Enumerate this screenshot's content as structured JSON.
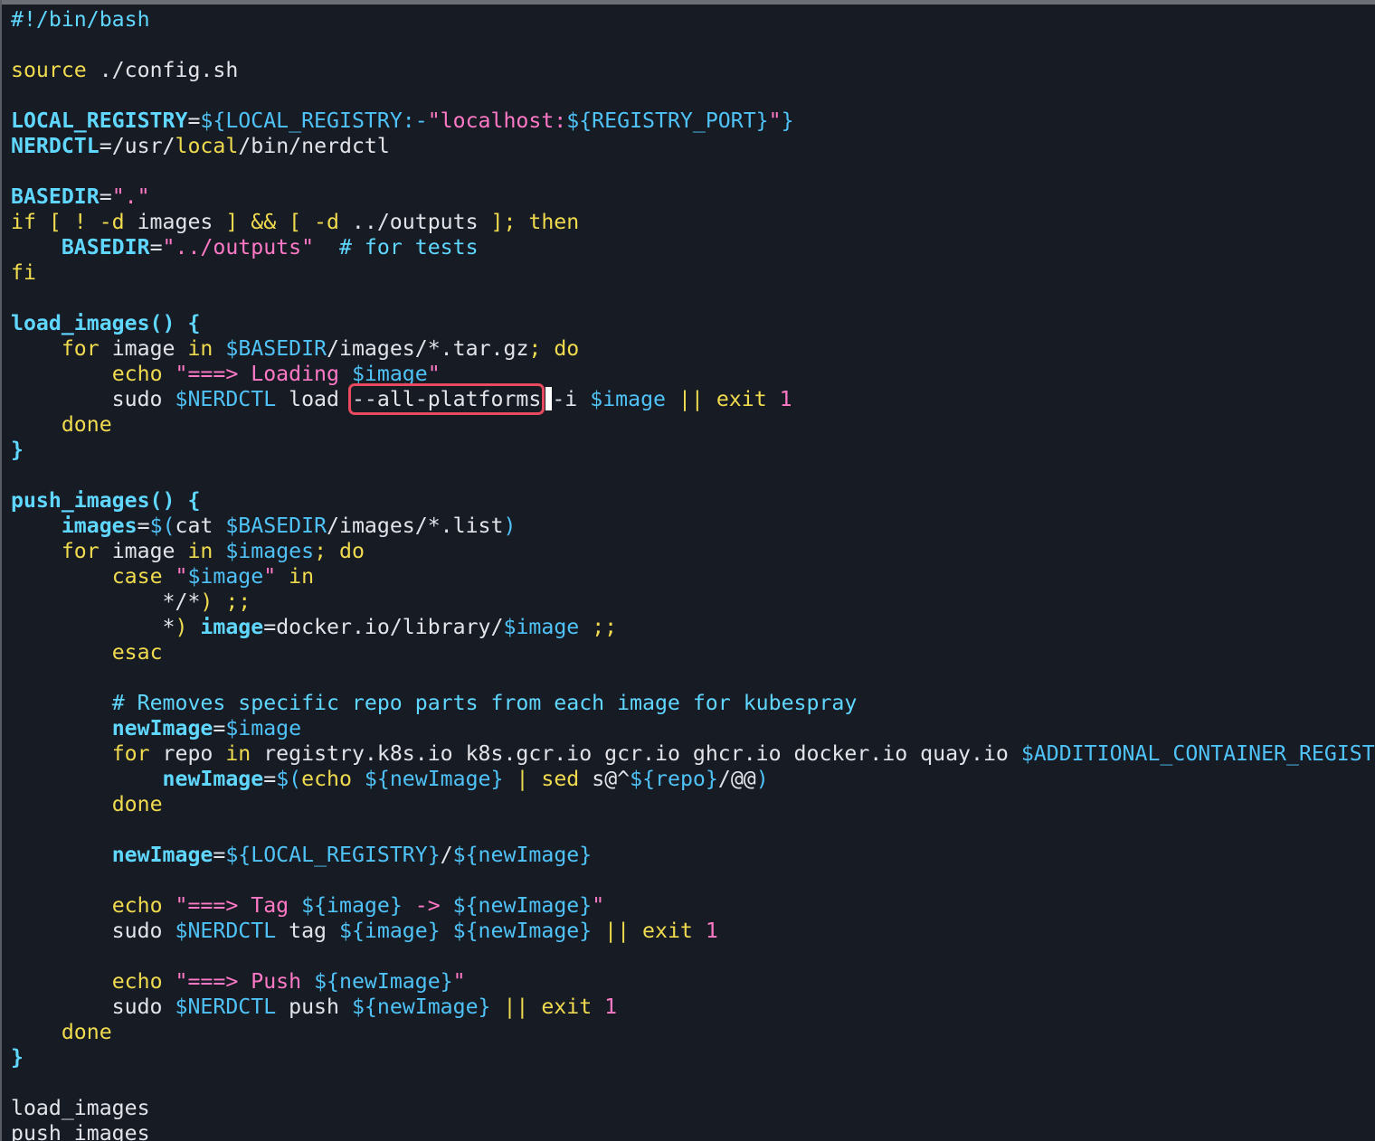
{
  "editor": {
    "colors": {
      "background": "#171b24",
      "text": "#e2e4e9",
      "keyword": "#f0db4f",
      "variable": "#5fd7ff",
      "string": "#ff79c6",
      "highlight_box": "#e84a5f"
    },
    "lines": [
      [
        {
          "t": "comment",
          "s": "#!/bin/bash"
        }
      ],
      [],
      [
        {
          "t": "keyword",
          "s": "source"
        },
        {
          "t": "plain",
          "s": " ./config.sh"
        }
      ],
      [],
      [
        {
          "t": "var",
          "s": "LOCAL_REGISTRY"
        },
        {
          "t": "plain",
          "s": "="
        },
        {
          "t": "varref",
          "s": "${LOCAL_REGISTRY:-"
        },
        {
          "t": "string",
          "s": "\"localhost:"
        },
        {
          "t": "varref",
          "s": "${REGISTRY_PORT}"
        },
        {
          "t": "string",
          "s": "\""
        },
        {
          "t": "varref",
          "s": "}"
        }
      ],
      [
        {
          "t": "var",
          "s": "NERDCTL"
        },
        {
          "t": "plain",
          "s": "=/usr/"
        },
        {
          "t": "keyword",
          "s": "local"
        },
        {
          "t": "plain",
          "s": "/bin/nerdctl"
        }
      ],
      [],
      [
        {
          "t": "var",
          "s": "BASEDIR"
        },
        {
          "t": "plain",
          "s": "="
        },
        {
          "t": "string",
          "s": "\".\""
        }
      ],
      [
        {
          "t": "keyword",
          "s": "if [ ! -d"
        },
        {
          "t": "plain",
          "s": " images "
        },
        {
          "t": "keyword",
          "s": "] && [ -d"
        },
        {
          "t": "plain",
          "s": " ../outputs "
        },
        {
          "t": "keyword",
          "s": "]; then"
        }
      ],
      [
        {
          "t": "plain",
          "s": "    "
        },
        {
          "t": "var",
          "s": "BASEDIR"
        },
        {
          "t": "plain",
          "s": "="
        },
        {
          "t": "string",
          "s": "\"../outputs\""
        },
        {
          "t": "plain",
          "s": "  "
        },
        {
          "t": "comment",
          "s": "# for tests"
        }
      ],
      [
        {
          "t": "keyword",
          "s": "fi"
        }
      ],
      [],
      [
        {
          "t": "func",
          "s": "load_images() {"
        }
      ],
      [
        {
          "t": "plain",
          "s": "    "
        },
        {
          "t": "keyword",
          "s": "for"
        },
        {
          "t": "plain",
          "s": " image "
        },
        {
          "t": "keyword",
          "s": "in"
        },
        {
          "t": "plain",
          "s": " "
        },
        {
          "t": "varref",
          "s": "$BASEDIR"
        },
        {
          "t": "plain",
          "s": "/images/*.tar.gz"
        },
        {
          "t": "keyword",
          "s": "; do"
        }
      ],
      [
        {
          "t": "plain",
          "s": "        "
        },
        {
          "t": "keyword",
          "s": "echo"
        },
        {
          "t": "plain",
          "s": " "
        },
        {
          "t": "string",
          "s": "\"===> Loading "
        },
        {
          "t": "varref",
          "s": "$image"
        },
        {
          "t": "string",
          "s": "\""
        }
      ],
      [
        {
          "t": "plain",
          "s": "        sudo "
        },
        {
          "t": "varref",
          "s": "$NERDCTL"
        },
        {
          "t": "plain",
          "s": " load "
        },
        {
          "t": "hl",
          "s": "--all-platforms"
        },
        {
          "t": "cursor",
          "s": ""
        },
        {
          "t": "plain",
          "s": "-i "
        },
        {
          "t": "varref",
          "s": "$image"
        },
        {
          "t": "plain",
          "s": " "
        },
        {
          "t": "keyword",
          "s": "|| exit"
        },
        {
          "t": "plain",
          "s": " "
        },
        {
          "t": "num",
          "s": "1"
        }
      ],
      [
        {
          "t": "plain",
          "s": "    "
        },
        {
          "t": "keyword",
          "s": "done"
        }
      ],
      [
        {
          "t": "brace",
          "s": "}"
        }
      ],
      [],
      [
        {
          "t": "func",
          "s": "push_images() {"
        }
      ],
      [
        {
          "t": "plain",
          "s": "    "
        },
        {
          "t": "var",
          "s": "images"
        },
        {
          "t": "plain",
          "s": "="
        },
        {
          "t": "varref",
          "s": "$("
        },
        {
          "t": "plain",
          "s": "cat "
        },
        {
          "t": "varref",
          "s": "$BASEDIR"
        },
        {
          "t": "plain",
          "s": "/images/*.list"
        },
        {
          "t": "varref",
          "s": ")"
        }
      ],
      [
        {
          "t": "plain",
          "s": "    "
        },
        {
          "t": "keyword",
          "s": "for"
        },
        {
          "t": "plain",
          "s": " image "
        },
        {
          "t": "keyword",
          "s": "in"
        },
        {
          "t": "plain",
          "s": " "
        },
        {
          "t": "varref",
          "s": "$images"
        },
        {
          "t": "keyword",
          "s": "; do"
        }
      ],
      [
        {
          "t": "plain",
          "s": "        "
        },
        {
          "t": "keyword",
          "s": "case"
        },
        {
          "t": "plain",
          "s": " "
        },
        {
          "t": "string",
          "s": "\""
        },
        {
          "t": "varref",
          "s": "$image"
        },
        {
          "t": "string",
          "s": "\""
        },
        {
          "t": "plain",
          "s": " "
        },
        {
          "t": "keyword",
          "s": "in"
        }
      ],
      [
        {
          "t": "plain",
          "s": "            */*"
        },
        {
          "t": "keyword",
          "s": ") ;;"
        }
      ],
      [
        {
          "t": "plain",
          "s": "            *"
        },
        {
          "t": "keyword",
          "s": ")"
        },
        {
          "t": "plain",
          "s": " "
        },
        {
          "t": "var",
          "s": "image"
        },
        {
          "t": "plain",
          "s": "=docker.io/library/"
        },
        {
          "t": "varref",
          "s": "$image"
        },
        {
          "t": "plain",
          "s": " "
        },
        {
          "t": "keyword",
          "s": ";;"
        }
      ],
      [
        {
          "t": "plain",
          "s": "        "
        },
        {
          "t": "keyword",
          "s": "esac"
        }
      ],
      [],
      [
        {
          "t": "plain",
          "s": "        "
        },
        {
          "t": "comment",
          "s": "# Removes specific repo parts from each image for kubespray"
        }
      ],
      [
        {
          "t": "plain",
          "s": "        "
        },
        {
          "t": "var",
          "s": "newImage"
        },
        {
          "t": "plain",
          "s": "="
        },
        {
          "t": "varref",
          "s": "$image"
        }
      ],
      [
        {
          "t": "plain",
          "s": "        "
        },
        {
          "t": "keyword",
          "s": "for"
        },
        {
          "t": "plain",
          "s": " repo "
        },
        {
          "t": "keyword",
          "s": "in"
        },
        {
          "t": "plain",
          "s": " registry.k8s.io k8s.gcr.io gcr.io ghcr.io docker.io quay.io "
        },
        {
          "t": "varref",
          "s": "$ADDITIONAL_CONTAINER_REGIST"
        }
      ],
      [
        {
          "t": "plain",
          "s": "            "
        },
        {
          "t": "var",
          "s": "newImage"
        },
        {
          "t": "plain",
          "s": "="
        },
        {
          "t": "varref",
          "s": "$("
        },
        {
          "t": "keyword",
          "s": "echo"
        },
        {
          "t": "plain",
          "s": " "
        },
        {
          "t": "varref",
          "s": "${newImage}"
        },
        {
          "t": "plain",
          "s": " "
        },
        {
          "t": "keyword",
          "s": "|"
        },
        {
          "t": "plain",
          "s": " "
        },
        {
          "t": "keyword",
          "s": "sed"
        },
        {
          "t": "plain",
          "s": " s@^"
        },
        {
          "t": "varref",
          "s": "${repo}"
        },
        {
          "t": "plain",
          "s": "/@@"
        },
        {
          "t": "varref",
          "s": ")"
        }
      ],
      [
        {
          "t": "plain",
          "s": "        "
        },
        {
          "t": "keyword",
          "s": "done"
        }
      ],
      [],
      [
        {
          "t": "plain",
          "s": "        "
        },
        {
          "t": "var",
          "s": "newImage"
        },
        {
          "t": "plain",
          "s": "="
        },
        {
          "t": "varref",
          "s": "${LOCAL_REGISTRY}"
        },
        {
          "t": "plain",
          "s": "/"
        },
        {
          "t": "varref",
          "s": "${newImage}"
        }
      ],
      [],
      [
        {
          "t": "plain",
          "s": "        "
        },
        {
          "t": "keyword",
          "s": "echo"
        },
        {
          "t": "plain",
          "s": " "
        },
        {
          "t": "string",
          "s": "\"===> Tag "
        },
        {
          "t": "varref",
          "s": "${image}"
        },
        {
          "t": "string",
          "s": " -> "
        },
        {
          "t": "varref",
          "s": "${newImage}"
        },
        {
          "t": "string",
          "s": "\""
        }
      ],
      [
        {
          "t": "plain",
          "s": "        sudo "
        },
        {
          "t": "varref",
          "s": "$NERDCTL"
        },
        {
          "t": "plain",
          "s": " tag "
        },
        {
          "t": "varref",
          "s": "${image}"
        },
        {
          "t": "plain",
          "s": " "
        },
        {
          "t": "varref",
          "s": "${newImage}"
        },
        {
          "t": "plain",
          "s": " "
        },
        {
          "t": "keyword",
          "s": "|| exit"
        },
        {
          "t": "plain",
          "s": " "
        },
        {
          "t": "num",
          "s": "1"
        }
      ],
      [],
      [
        {
          "t": "plain",
          "s": "        "
        },
        {
          "t": "keyword",
          "s": "echo"
        },
        {
          "t": "plain",
          "s": " "
        },
        {
          "t": "string",
          "s": "\"===> Push "
        },
        {
          "t": "varref",
          "s": "${newImage}"
        },
        {
          "t": "string",
          "s": "\""
        }
      ],
      [
        {
          "t": "plain",
          "s": "        sudo "
        },
        {
          "t": "varref",
          "s": "$NERDCTL"
        },
        {
          "t": "plain",
          "s": " push "
        },
        {
          "t": "varref",
          "s": "${newImage}"
        },
        {
          "t": "plain",
          "s": " "
        },
        {
          "t": "keyword",
          "s": "|| exit"
        },
        {
          "t": "plain",
          "s": " "
        },
        {
          "t": "num",
          "s": "1"
        }
      ],
      [
        {
          "t": "plain",
          "s": "    "
        },
        {
          "t": "keyword",
          "s": "done"
        }
      ],
      [
        {
          "t": "brace",
          "s": "}"
        }
      ],
      [],
      [
        {
          "t": "plain",
          "s": "load_images"
        }
      ],
      [
        {
          "t": "plain",
          "s": "push_images"
        }
      ]
    ]
  }
}
